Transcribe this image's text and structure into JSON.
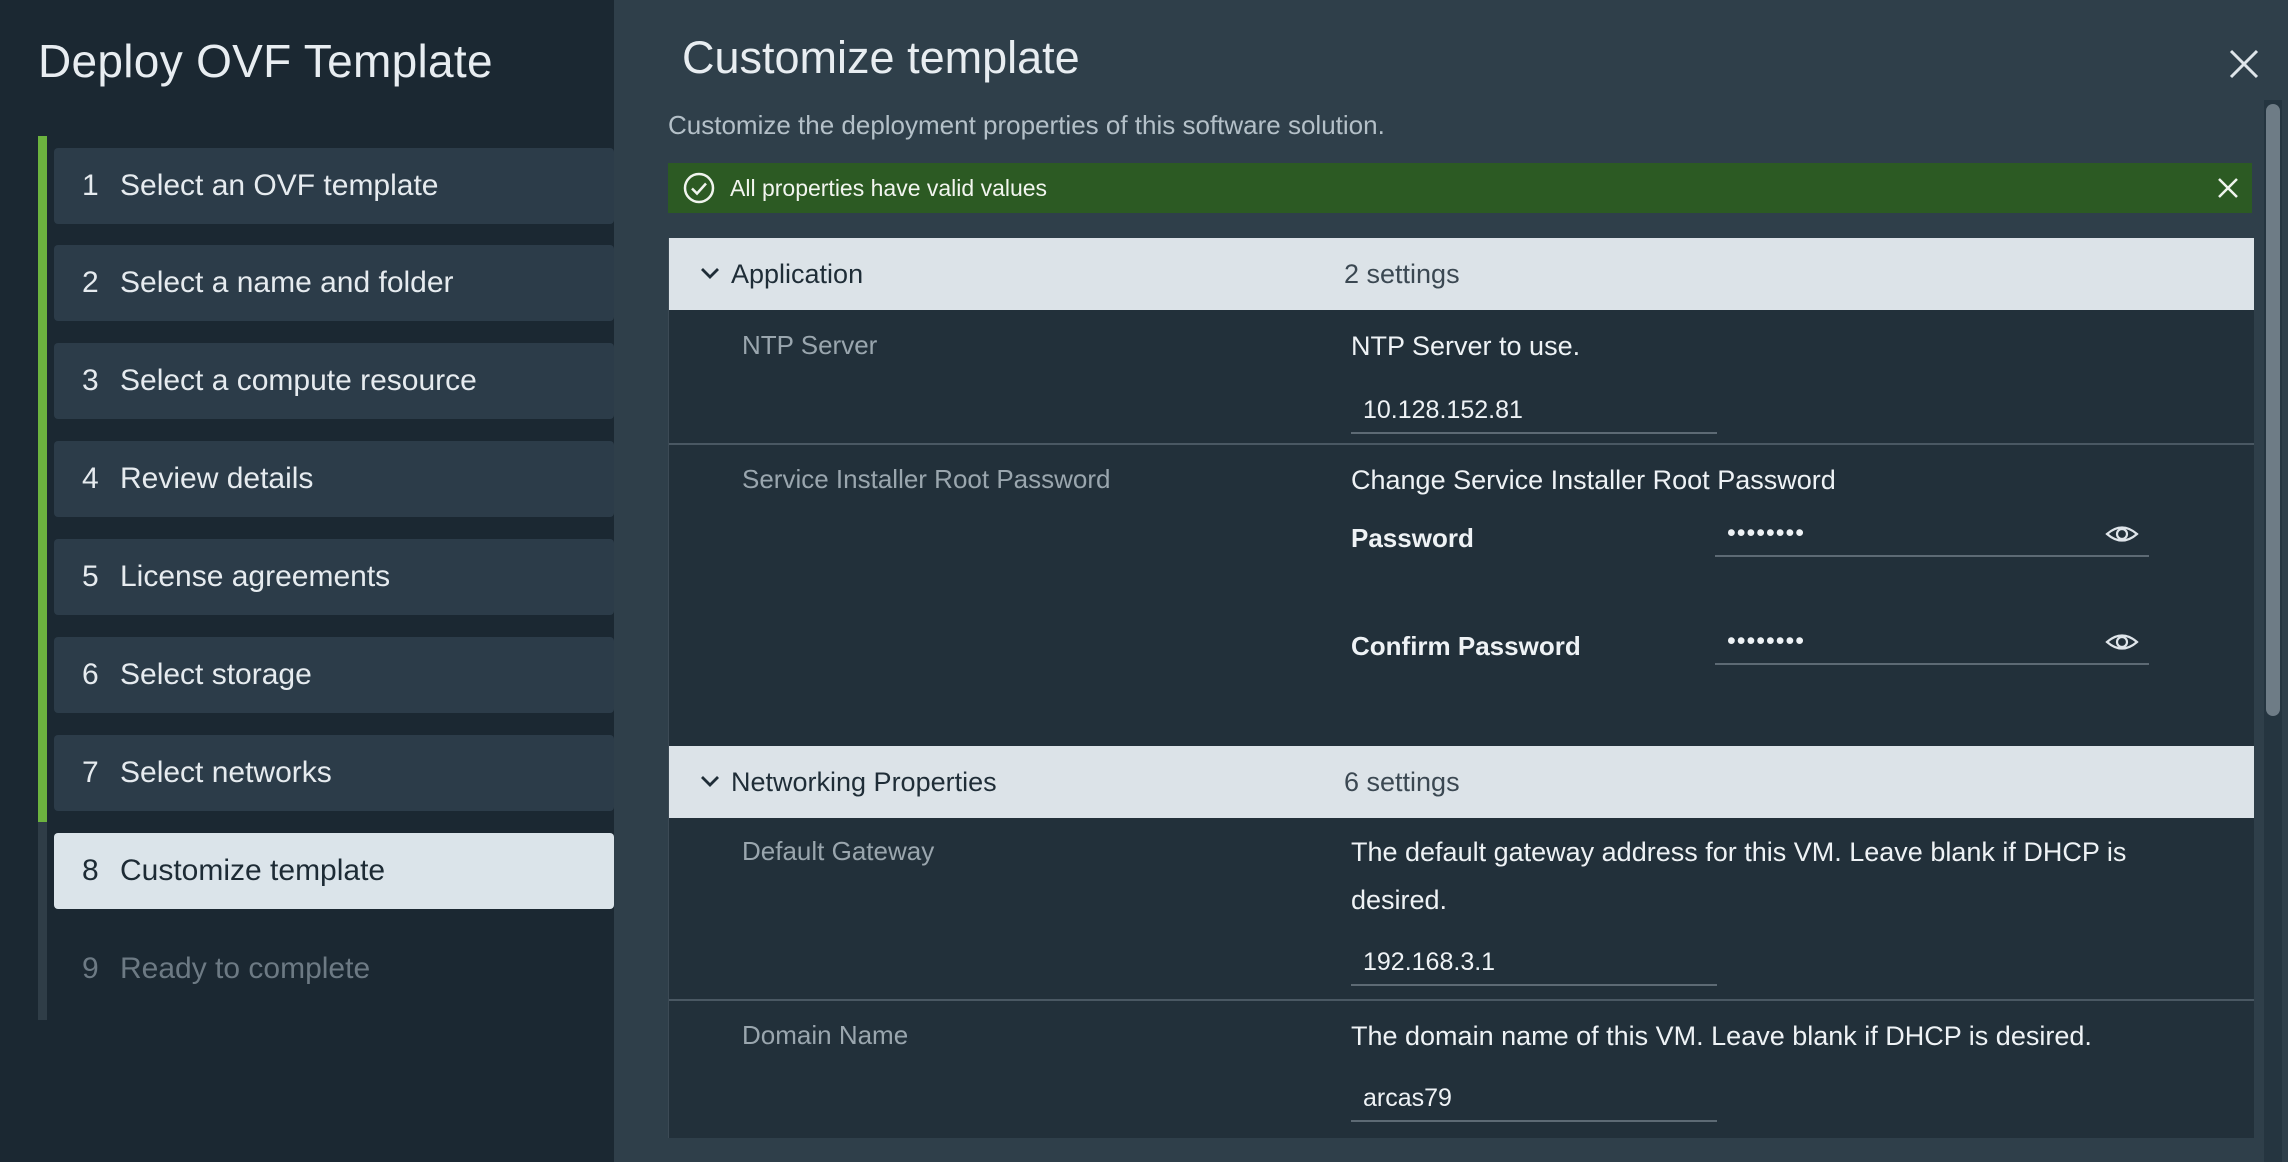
{
  "wizard": {
    "title": "Deploy OVF Template",
    "steps": [
      {
        "num": "1",
        "label": "Select an OVF template"
      },
      {
        "num": "2",
        "label": "Select a name and folder"
      },
      {
        "num": "3",
        "label": "Select a compute resource"
      },
      {
        "num": "4",
        "label": "Review details"
      },
      {
        "num": "5",
        "label": "License agreements"
      },
      {
        "num": "6",
        "label": "Select storage"
      },
      {
        "num": "7",
        "label": "Select networks"
      },
      {
        "num": "8",
        "label": "Customize template"
      },
      {
        "num": "9",
        "label": "Ready to complete"
      }
    ]
  },
  "main": {
    "title": "Customize template",
    "subtitle": "Customize the deployment properties of this software solution.",
    "alert": "All properties have valid values"
  },
  "groups": [
    {
      "name": "Application",
      "count": "2 settings",
      "properties": [
        {
          "label": "NTP Server",
          "description": "NTP Server to use.",
          "value": "10.128.152.81"
        },
        {
          "label": "Service Installer Root Password",
          "description": "Change Service Installer Root Password",
          "password_label": "Password",
          "password_value": "••••••••",
          "confirm_label": "Confirm Password",
          "confirm_value": "••••••••"
        }
      ]
    },
    {
      "name": "Networking Properties",
      "count": "6 settings",
      "properties": [
        {
          "label": "Default Gateway",
          "description": "The default gateway address for this VM. Leave blank if DHCP is desired.",
          "value": "192.168.3.1"
        },
        {
          "label": "Domain Name",
          "description": "The domain name of this VM. Leave blank if DHCP is desired.",
          "value": "arcas79"
        }
      ]
    }
  ],
  "colors": {
    "progress": "#6cb33f",
    "alert_bg": "#2c5a23",
    "active_step_bg": "#dbe4ea"
  },
  "icons": {
    "close": "close-icon",
    "alert_ok": "check-circle-icon",
    "chevron": "chevron-down-icon",
    "reveal": "eye-icon"
  },
  "wizard_progress": {
    "completed_steps": 7,
    "current_step": 8,
    "total_steps": 9
  }
}
